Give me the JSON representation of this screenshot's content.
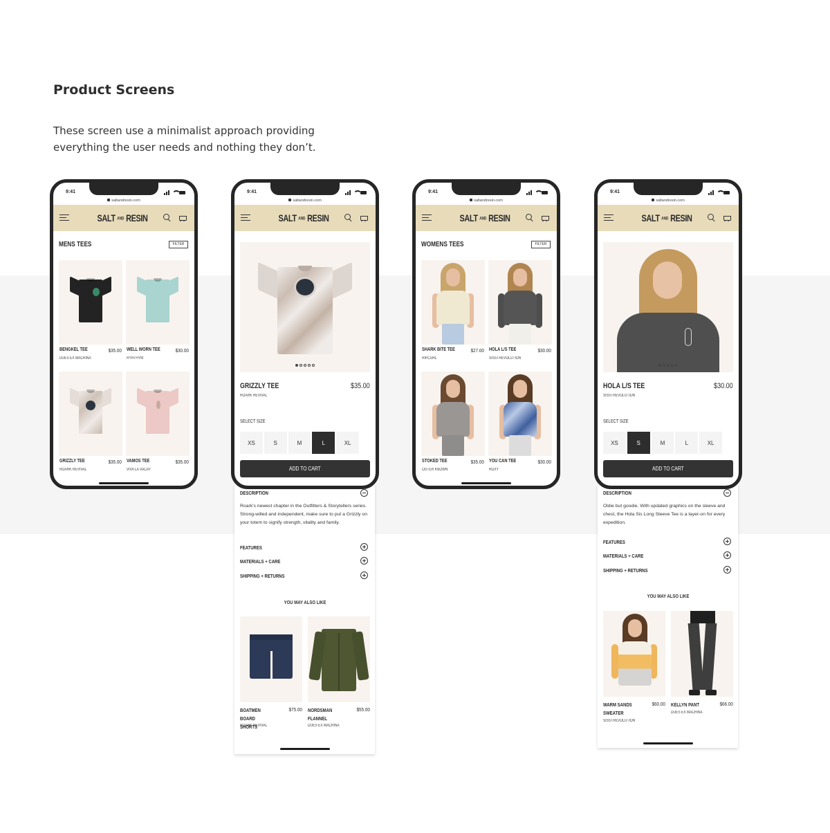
{
  "page": {
    "heading": "Product Screens",
    "subtext": "These screen use a minimalist approach providing everything the user needs and nothing they don’t."
  },
  "device": {
    "time": "9:41",
    "url": "saltandresin.com"
  },
  "brand": {
    "logo_left": "SALT",
    "logo_and": "AND",
    "logo_right": "RESIN"
  },
  "colors": {
    "header_bg": "#e7dbba",
    "primary_button": "#333333",
    "tile_bg": "#f8f3ee"
  },
  "icons": [
    "hamburger-menu-icon",
    "search-icon",
    "cart-icon",
    "lock-icon",
    "collapse-icon",
    "expand-icon"
  ],
  "mens": {
    "title": "MENS TEES",
    "filter": "FILTER",
    "products": [
      {
        "name": "BENGKEL TEE",
        "price": "$35.00",
        "brand": "DUES EX MACHINA"
      },
      {
        "name": "WELL WORN TEE",
        "price": "$30.00",
        "brand": "RYHTHYM"
      },
      {
        "name": "GRIZZLY TEE",
        "price": "$35.00",
        "brand": "ROARK REVIVAL"
      },
      {
        "name": "VAMOS TEE",
        "price": "$35.00",
        "brand": "VIVA LA VACAY"
      }
    ]
  },
  "pdp_grizzly": {
    "name": "GRIZZLY TEE",
    "price": "$35.00",
    "brand": "ROARK REVIVAL",
    "select_size": "SELECT SIZE",
    "sizes": [
      "XS",
      "S",
      "M",
      "L",
      "XL"
    ],
    "selected_size": "L",
    "add_to_cart": "ADD TO CART",
    "description_title": "DESCRIPTION",
    "description": "Roark’s newest chapter in the Outfitters & Storytellers series. Strong-willed and independent, make sure to put a Grizzly on your totem to signify strength, vitality and family.",
    "features": "FEATURES",
    "materials": "MATERIALS + CARE",
    "shipping": "SHIPPING + RETURNS",
    "you_may_also_like": "YOU MAY ALSO LIKE",
    "recommendations": [
      {
        "name": "BOATMEN BOARD SHORTS",
        "price": "$75.00",
        "brand": "ROARK REVIVAL"
      },
      {
        "name": "NORDSMAN FLANNEL",
        "price": "$55.00",
        "brand": "DUES EX MACHINA"
      }
    ]
  },
  "womens": {
    "title": "WOMENS TEES",
    "filter": "FILTER",
    "products": [
      {
        "name": "SHARK BITE TEE",
        "price": "$27.00",
        "brand": "RIPCURL"
      },
      {
        "name": "HOLA L/S TEE",
        "price": "$30.00",
        "brand": "SISSTREVOLUTION"
      },
      {
        "name": "STOKED TEE",
        "price": "$35.00",
        "brand": "OUTER KNOWN"
      },
      {
        "name": "YOU CAN TEE",
        "price": "$30.00",
        "brand": "ROXY"
      }
    ]
  },
  "pdp_hola": {
    "name": "HOLA L/S TEE",
    "price": "$30.00",
    "brand": "SISSTREVOLUTION",
    "select_size": "SELECT SIZE",
    "sizes": [
      "XS",
      "S",
      "M",
      "L",
      "XL"
    ],
    "selected_size": "S",
    "add_to_cart": "ADD TO CART",
    "description_title": "DESCRIPTION",
    "description": "Oldie but goodie. With updated graphics on the sleeve and chest, the Hola Sis Long Sleeve Tee is a layer-on for every expedition.",
    "features": "FEATURES",
    "materials": "MATERIALS + CARE",
    "shipping": "SHIPPING + RETURNS",
    "you_may_also_like": "YOU MAY ALSO LIKE",
    "recommendations": [
      {
        "name": "WARM SANDS SWEATER",
        "price": "$60.00",
        "brand": "SISSTREVOLUTION"
      },
      {
        "name": "KELLYN PANT",
        "price": "$66.00",
        "brand": "DUES EX MACHINA"
      }
    ]
  }
}
